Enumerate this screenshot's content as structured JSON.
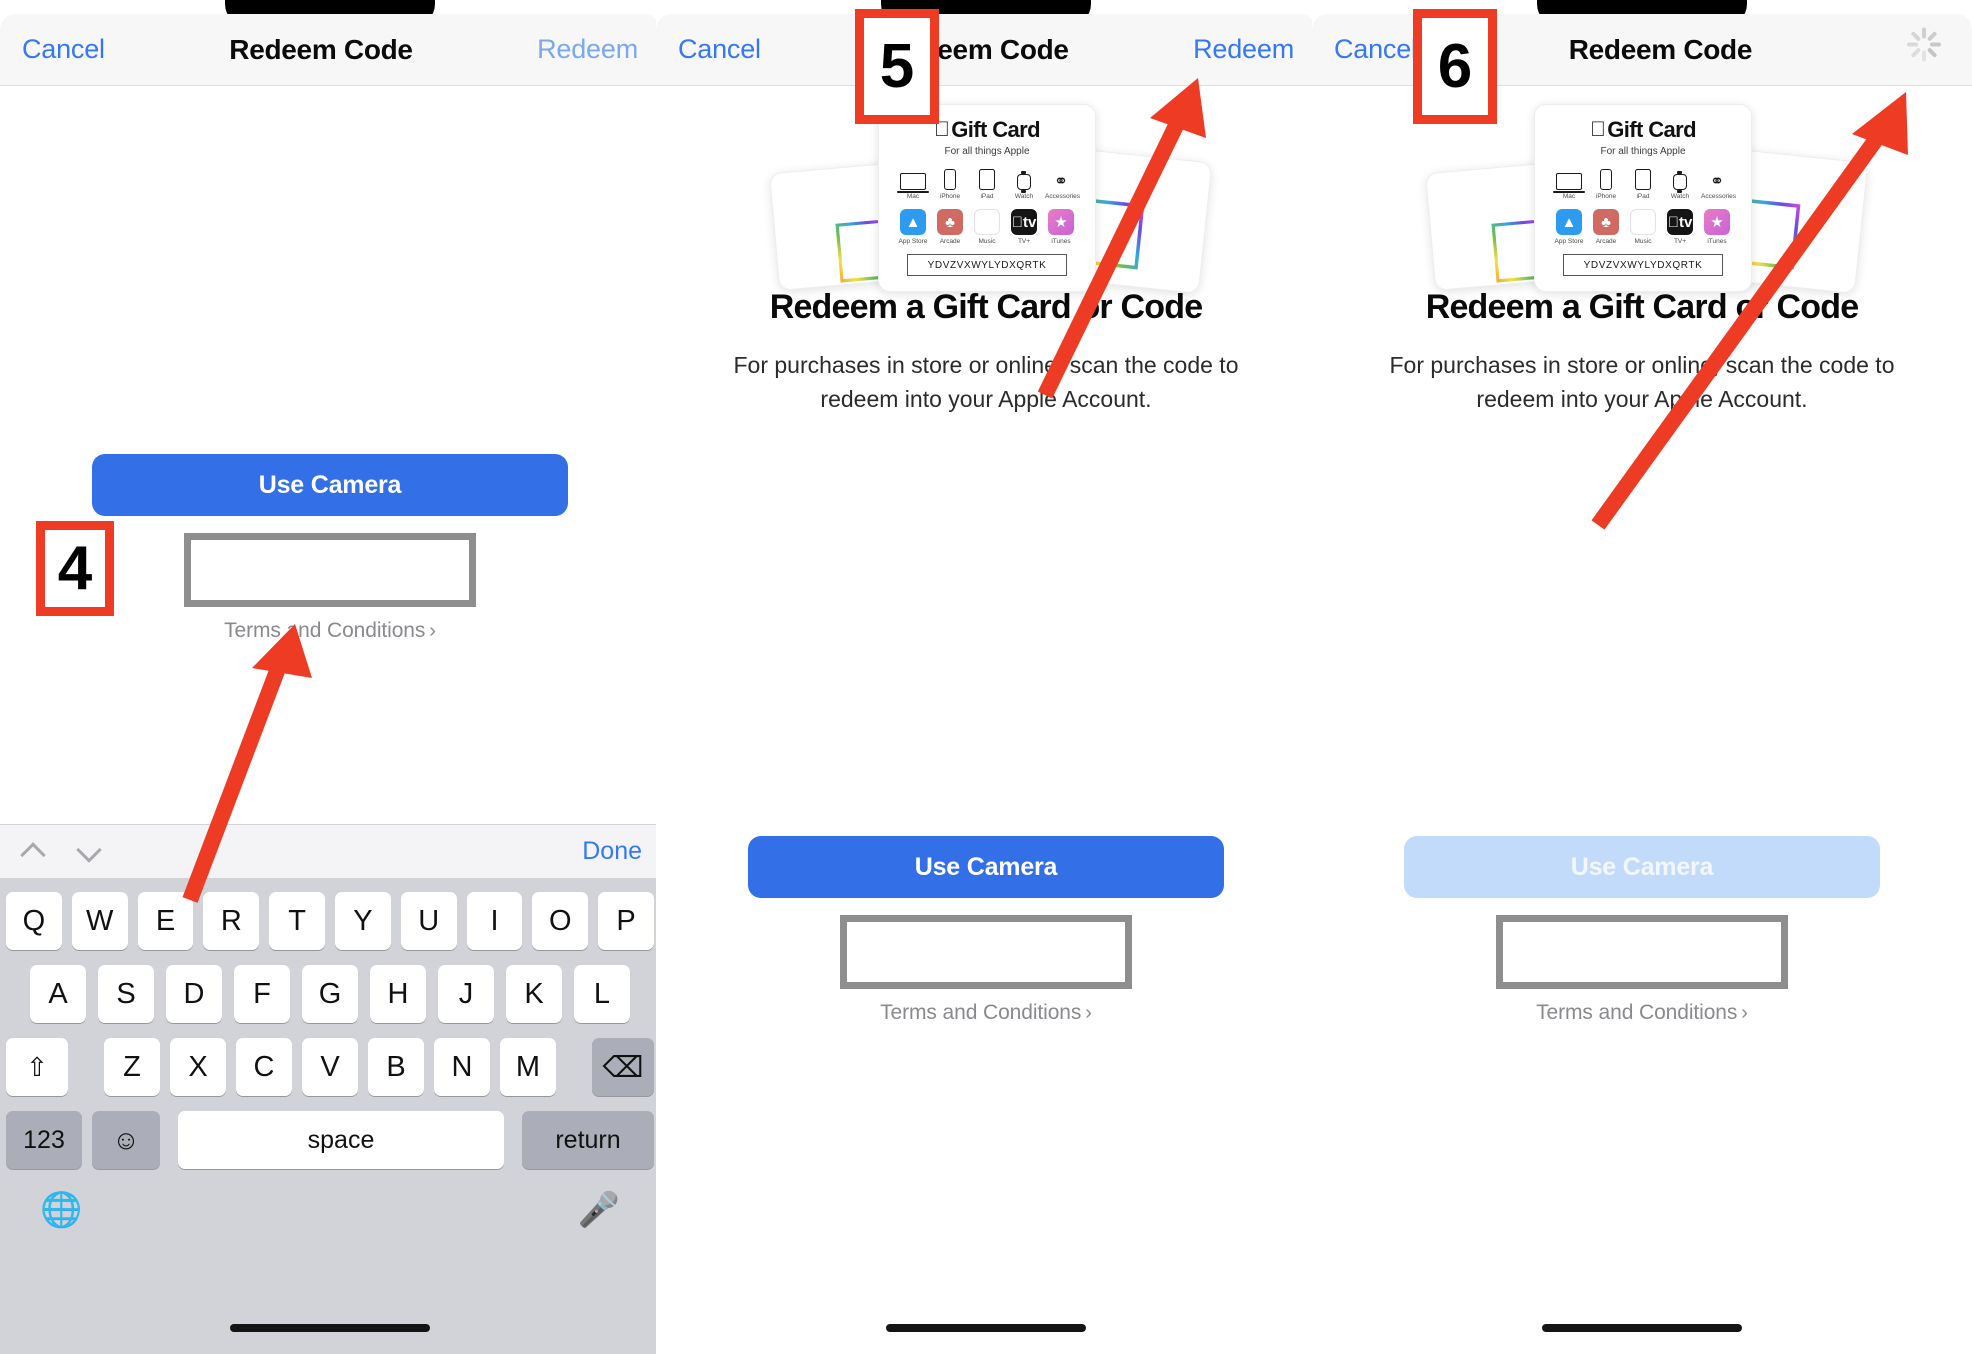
{
  "panels": [
    {
      "id": "panel-1",
      "nav": {
        "cancel": "Cancel",
        "title": "Redeem Code",
        "redeem": "Redeem",
        "redeem_state": "disabled"
      },
      "use_camera": "Use Camera",
      "terms": "Terms and Conditions",
      "terms_chevron": "›",
      "code_field_value": "",
      "keyboard": {
        "done": "Done",
        "row1": [
          "Q",
          "W",
          "E",
          "R",
          "T",
          "Y",
          "U",
          "I",
          "O",
          "P"
        ],
        "row2": [
          "A",
          "S",
          "D",
          "F",
          "G",
          "H",
          "J",
          "K",
          "L"
        ],
        "row3_shift": "⇧",
        "row3": [
          "Z",
          "X",
          "C",
          "V",
          "B",
          "N",
          "M"
        ],
        "row3_backspace": "⌫",
        "numbers_key": "123",
        "emoji_key": "☺",
        "space_key": "space",
        "return_key": "return",
        "globe_icon": "globe-icon",
        "mic_icon": "microphone-icon",
        "chevron_up_icon": "chevron-up-icon",
        "chevron_down_icon": "chevron-down-icon"
      }
    },
    {
      "id": "panel-2",
      "nav": {
        "cancel": "Cancel",
        "title": "Redeem Code",
        "redeem": "Redeem",
        "redeem_state": "enabled"
      },
      "headline": "Redeem a Gift Card or Code",
      "subcopy": "For purchases in store or online, scan the code to redeem into your Apple Account.",
      "use_camera": "Use Camera",
      "use_camera_state": "enabled",
      "terms": "Terms and Conditions",
      "terms_chevron": "›",
      "code_field_value": ""
    },
    {
      "id": "panel-3",
      "nav": {
        "cancel": "Cancel",
        "title": "Redeem Code",
        "redeem": "",
        "redeem_state": "loading"
      },
      "headline": "Redeem a Gift Card or Code",
      "subcopy": "For purchases in store or online, scan the code to redeem into your Apple Account.",
      "use_camera": "Use Camera",
      "use_camera_state": "disabled",
      "terms": "Terms and Conditions",
      "terms_chevron": "›",
      "code_field_value": ""
    }
  ],
  "gift_card": {
    "logo_apple": "",
    "logo_text": "Gift Card",
    "tagline": "For all things Apple",
    "devices": [
      {
        "label": "Mac",
        "icon": "laptop-icon"
      },
      {
        "label": "iPhone",
        "icon": "iphone-icon"
      },
      {
        "label": "iPad",
        "icon": "ipad-icon"
      },
      {
        "label": "Watch",
        "icon": "watch-icon"
      },
      {
        "label": "Accessories",
        "icon": "airpods-icon"
      }
    ],
    "services": [
      {
        "label": "App Store",
        "glyph": "A",
        "color": "#2d9cf0"
      },
      {
        "label": "Arcade",
        "glyph": "♟",
        "color": "#cf6b63"
      },
      {
        "label": "Music",
        "glyph": "♫",
        "color": "#fb3a5d"
      },
      {
        "label": "TV+",
        "glyph": "tv",
        "color": "#151515"
      },
      {
        "label": "iTunes",
        "glyph": "★",
        "color": "#c863d8"
      }
    ],
    "code": "YDVZVXWYLYDXQRTK"
  },
  "annotations": {
    "steps": [
      {
        "number": "4",
        "target": "terms-and-conditions-link"
      },
      {
        "number": "5",
        "target": "redeem-button"
      },
      {
        "number": "6",
        "target": "loading-spinner"
      }
    ],
    "arrow_color": "#ee3b24",
    "box_border_color": "#ee3b24"
  },
  "colors": {
    "ios_blue": "#3478f6",
    "button_blue": "#3370e8",
    "button_blue_disabled": "#c2dbfb",
    "annotation_red": "#ee3b24",
    "keyboard_bg": "#d1d3d9",
    "navbar_bg": "#f7f7f7",
    "field_border": "#8e8e8e"
  }
}
